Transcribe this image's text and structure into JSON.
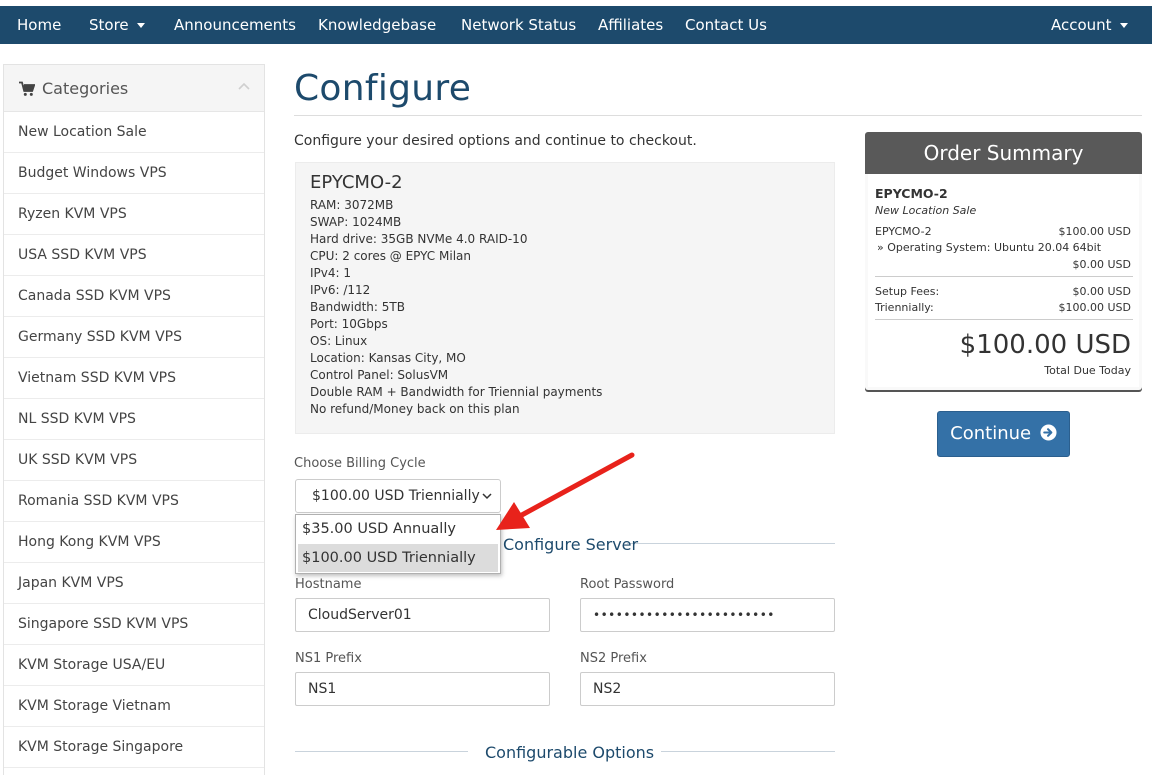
{
  "nav": {
    "home": "Home",
    "store": "Store",
    "announcements": "Announcements",
    "knowledgebase": "Knowledgebase",
    "network_status": "Network Status",
    "affiliates": "Affiliates",
    "contact_us": "Contact Us",
    "account": "Account"
  },
  "sidebar": {
    "title": "Categories",
    "items": [
      "New Location Sale",
      "Budget Windows VPS",
      "Ryzen KVM VPS",
      "USA SSD KVM VPS",
      "Canada SSD KVM VPS",
      "Germany SSD KVM VPS",
      "Vietnam SSD KVM VPS",
      "NL SSD KVM VPS",
      "UK SSD KVM VPS",
      "Romania SSD KVM VPS",
      "Hong Kong KVM VPS",
      "Japan KVM VPS",
      "Singapore SSD KVM VPS",
      "KVM Storage USA/EU",
      "KVM Storage Vietnam",
      "KVM Storage Singapore"
    ]
  },
  "page": {
    "title": "Configure",
    "intro": "Configure your desired options and continue to checkout."
  },
  "product": {
    "name": "EPYCMO-2",
    "specs": [
      "RAM: 3072MB",
      "SWAP: 1024MB",
      "Hard drive: 35GB NVMe 4.0 RAID-10",
      "CPU: 2 cores @ EPYC Milan",
      "IPv4: 1",
      "IPv6: /112",
      "Bandwidth: 5TB",
      "Port: 10Gbps",
      "OS: Linux",
      "Location: Kansas City, MO",
      "Control Panel: SolusVM",
      "Double RAM + Bandwidth for Triennial payments",
      "No refund/Money back on this plan"
    ]
  },
  "billing": {
    "label": "Choose Billing Cycle",
    "selected": "$100.00 USD Triennially",
    "options": [
      "$35.00 USD Annually",
      "$100.00 USD Triennially"
    ]
  },
  "configure_server": {
    "title": "Configure Server",
    "hostname_label": "Hostname",
    "hostname_value": "CloudServer01",
    "root_password_label": "Root Password",
    "root_password_value": "••••••••••••••••••••••••",
    "ns1_label": "NS1 Prefix",
    "ns1_value": "NS1",
    "ns2_label": "NS2 Prefix",
    "ns2_value": "NS2"
  },
  "configurable_options": {
    "title": "Configurable Options"
  },
  "summary": {
    "title": "Order Summary",
    "product_name": "EPYCMO-2",
    "group": "New Location Sale",
    "line_name": "EPYCMO-2",
    "line_price": "$100.00 USD",
    "os_line": "» Operating System: Ubuntu 20.04 64bit",
    "os_price": "$0.00 USD",
    "setup_label": "Setup Fees:",
    "setup_value": "$0.00 USD",
    "cycle_label": "Triennially:",
    "cycle_value": "$100.00 USD",
    "total": "$100.00 USD",
    "total_label": "Total Due Today"
  },
  "continue_label": "Continue",
  "colors": {
    "navbar": "#1d4a6c",
    "accent": "#3471a7",
    "summary_header": "#595959",
    "annotation_arrow": "#e8221b"
  }
}
